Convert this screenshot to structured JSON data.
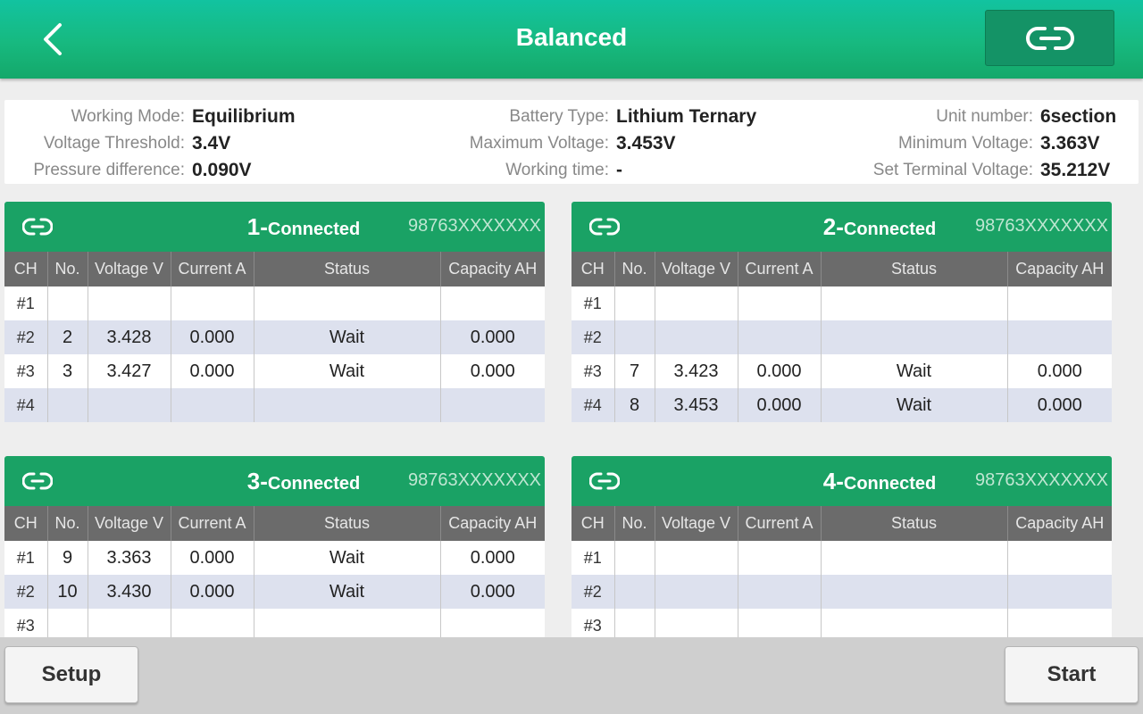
{
  "header": {
    "title": "Balanced",
    "accent": "#17b97f"
  },
  "info": {
    "working_mode": {
      "label": "Working Mode:",
      "value": "Equilibrium"
    },
    "voltage_threshold": {
      "label": "Voltage Threshold:",
      "value": "3.4V"
    },
    "pressure_difference": {
      "label": "Pressure difference:",
      "value": "0.090V"
    },
    "battery_type": {
      "label": "Battery Type:",
      "value": "Lithium Ternary"
    },
    "maximum_voltage": {
      "label": "Maximum Voltage:",
      "value": "3.453V"
    },
    "working_time": {
      "label": "Working time:",
      "value": "-"
    },
    "unit_number": {
      "label": "Unit number:",
      "value": "6section"
    },
    "minimum_voltage": {
      "label": "Minimum Voltage:",
      "value": "3.363V"
    },
    "set_terminal_voltage": {
      "label": "Set Terminal Voltage:",
      "value": "35.212V"
    }
  },
  "columns": [
    "CH",
    "No.",
    "Voltage V",
    "Current A",
    "Status",
    "Capacity AH"
  ],
  "panels": [
    {
      "number": "1-",
      "status": "Connected",
      "serial": "98763XXXXXXX",
      "rows": [
        {
          "ch": "#1",
          "no": "",
          "voltage": "",
          "current": "",
          "status": "",
          "capacity": ""
        },
        {
          "ch": "#2",
          "no": "2",
          "voltage": "3.428",
          "current": "0.000",
          "status": "Wait",
          "capacity": "0.000"
        },
        {
          "ch": "#3",
          "no": "3",
          "voltage": "3.427",
          "current": "0.000",
          "status": "Wait",
          "capacity": "0.000"
        },
        {
          "ch": "#4",
          "no": "",
          "voltage": "",
          "current": "",
          "status": "",
          "capacity": ""
        }
      ]
    },
    {
      "number": "2-",
      "status": "Connected",
      "serial": "98763XXXXXXX",
      "rows": [
        {
          "ch": "#1",
          "no": "",
          "voltage": "",
          "current": "",
          "status": "",
          "capacity": ""
        },
        {
          "ch": "#2",
          "no": "",
          "voltage": "",
          "current": "",
          "status": "",
          "capacity": ""
        },
        {
          "ch": "#3",
          "no": "7",
          "voltage": "3.423",
          "current": "0.000",
          "status": "Wait",
          "capacity": "0.000"
        },
        {
          "ch": "#4",
          "no": "8",
          "voltage": "3.453",
          "current": "0.000",
          "status": "Wait",
          "capacity": "0.000"
        }
      ]
    },
    {
      "number": "3-",
      "status": "Connected",
      "serial": "98763XXXXXXX",
      "rows": [
        {
          "ch": "#1",
          "no": "9",
          "voltage": "3.363",
          "current": "0.000",
          "status": "Wait",
          "capacity": "0.000"
        },
        {
          "ch": "#2",
          "no": "10",
          "voltage": "3.430",
          "current": "0.000",
          "status": "Wait",
          "capacity": "0.000"
        },
        {
          "ch": "#3",
          "no": "",
          "voltage": "",
          "current": "",
          "status": "",
          "capacity": ""
        }
      ]
    },
    {
      "number": "4-",
      "status": "Connected",
      "serial": "98763XXXXXXX",
      "rows": [
        {
          "ch": "#1",
          "no": "",
          "voltage": "",
          "current": "",
          "status": "",
          "capacity": ""
        },
        {
          "ch": "#2",
          "no": "",
          "voltage": "",
          "current": "",
          "status": "",
          "capacity": ""
        },
        {
          "ch": "#3",
          "no": "",
          "voltage": "",
          "current": "",
          "status": "",
          "capacity": ""
        }
      ]
    }
  ],
  "footer": {
    "setup_label": "Setup",
    "start_label": "Start"
  }
}
